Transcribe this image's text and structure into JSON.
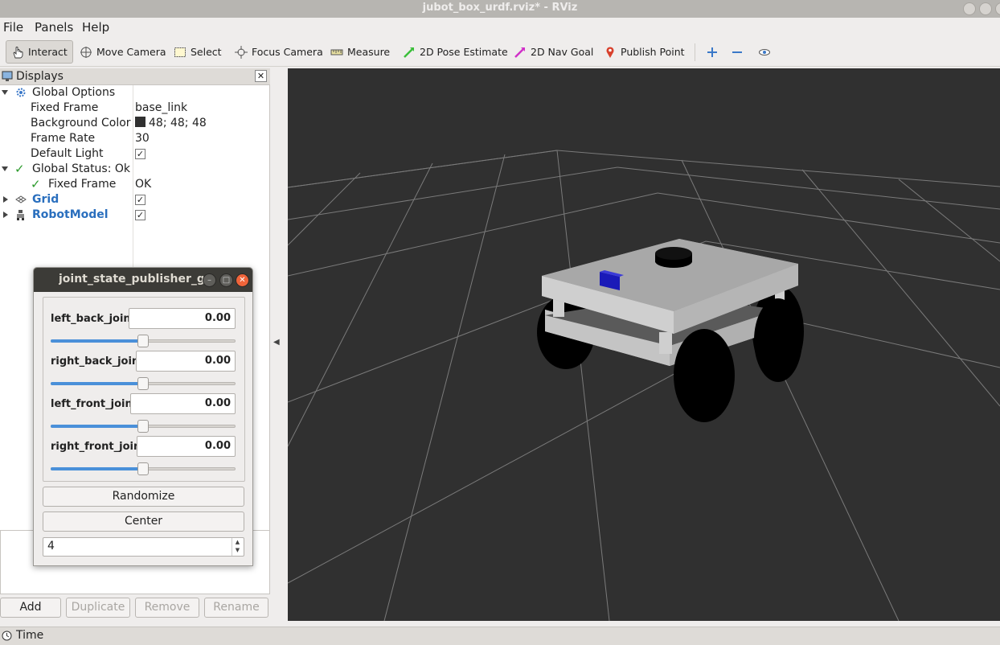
{
  "window": {
    "title": "jubot_box_urdf.rviz* - RViz"
  },
  "menu": [
    {
      "label": "File"
    },
    {
      "label": "Panels"
    },
    {
      "label": "Help"
    }
  ],
  "toolbar": {
    "tools": [
      {
        "label": "Interact",
        "icon": "hand-icon"
      },
      {
        "label": "Move Camera",
        "icon": "move-camera-icon"
      },
      {
        "label": "Select",
        "icon": "select-box-icon"
      },
      {
        "label": "Focus Camera",
        "icon": "focus-target-icon"
      },
      {
        "label": "Measure",
        "icon": "ruler-icon"
      },
      {
        "label": "2D Pose Estimate",
        "icon": "green-arrow-icon"
      },
      {
        "label": "2D Nav Goal",
        "icon": "magenta-arrow-icon"
      },
      {
        "label": "Publish Point",
        "icon": "map-pin-icon"
      }
    ],
    "active_tool": "Interact"
  },
  "displays": {
    "title": "Displays",
    "global_options": {
      "label": "Global Options",
      "fixed_frame": {
        "key": "Fixed Frame",
        "value": "base_link"
      },
      "background_color": {
        "key": "Background Color",
        "value": "48; 48; 48",
        "swatch": "#303030"
      },
      "frame_rate": {
        "key": "Frame Rate",
        "value": "30"
      },
      "default_light": {
        "key": "Default Light",
        "checked": true
      }
    },
    "global_status": {
      "label": "Global Status: Ok",
      "fixed_frame": {
        "key": "Fixed Frame",
        "value": "OK"
      }
    },
    "items": [
      {
        "label": "Grid",
        "checked": true
      },
      {
        "label": "RobotModel",
        "checked": true
      }
    ],
    "buttons": {
      "add": "Add",
      "duplicate": "Duplicate",
      "remove": "Remove",
      "rename": "Rename"
    }
  },
  "time_panel": {
    "title": "Time"
  },
  "joint_state_publisher": {
    "title": "joint_state_publisher_gui",
    "joints": [
      {
        "name": "left_back_joint",
        "value": "0.00",
        "slider_fraction": 0.5
      },
      {
        "name": "right_back_joint",
        "value": "0.00",
        "slider_fraction": 0.5
      },
      {
        "name": "left_front_joint",
        "value": "0.00",
        "slider_fraction": 0.5
      },
      {
        "name": "right_front_joint",
        "value": "0.00",
        "slider_fraction": 0.5
      }
    ],
    "randomize_label": "Randomize",
    "center_label": "Center",
    "spinbox_value": "4"
  },
  "colors": {
    "viewport_bg": "#303030",
    "accent_blue": "#2a6fbe",
    "slider_fill": "#4a90d9",
    "close_button": "#f0643a"
  }
}
